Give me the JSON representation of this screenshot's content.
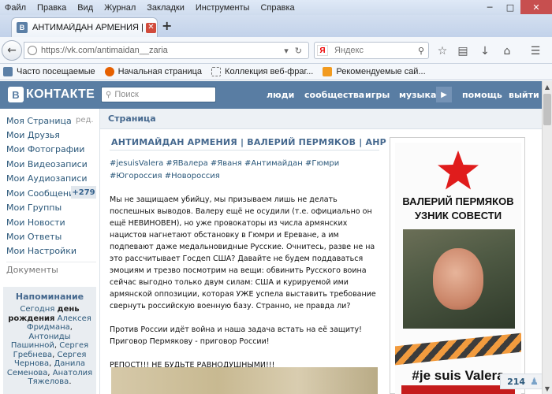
{
  "browser": {
    "menu": [
      "Файл",
      "Правка",
      "Вид",
      "Журнал",
      "Закладки",
      "Инструменты",
      "Справка"
    ],
    "tab_title": "АНТИМАЙДАН АРМЕНИЯ | В...",
    "tab_favicon": "В",
    "url": "https://vk.com/antimaidan__zaria",
    "search_engine_logo": "Я",
    "search_placeholder": "Яндекс",
    "bookmarks": [
      {
        "label": "Часто посещаемые",
        "icon": "vk-icon"
      },
      {
        "label": "Начальная страница",
        "icon": "firefox-icon"
      },
      {
        "label": "Коллекция веб-фраг...",
        "icon": "webslice-icon"
      },
      {
        "label": "Рекомендуемые сай...",
        "icon": "bookmark-icon"
      }
    ],
    "new_tab": "+",
    "tab_close": "✕"
  },
  "vk": {
    "logo_letter": "В",
    "logo_text": "КОНТАКТЕ",
    "search_placeholder": "Поиск",
    "nav": [
      "люди",
      "сообщества",
      "игры",
      "музыка",
      "помощь",
      "выйти"
    ]
  },
  "sidebar": {
    "items": [
      "Моя Страница",
      "Мои Друзья",
      "Мои Фотографии",
      "Мои Видеозаписи",
      "Мои Аудиозаписи",
      "Мои Сообщения",
      "Мои Группы",
      "Мои Новости",
      "Мои Ответы",
      "Мои Настройки"
    ],
    "edit_label": "ред.",
    "messages_count": "+279",
    "documents": "Документы",
    "reminder_title": "Напоминание",
    "reminder_today": "Сегодня",
    "reminder_birthday": "день рождения",
    "reminder_names": [
      "Алексея Фридмана",
      "Антониды Пашинной",
      "Сергея Гребнева",
      "Сергея Чернова",
      "Данила Семенова",
      "Анатолия Тяжелова"
    ]
  },
  "main": {
    "header": "Страница",
    "post_title": "АНТИМАЙДАН АРМЕНИЯ | ВАЛЕРИЙ ПЕРМЯКОВ | АНР",
    "tags": "#jesuisValera #ЯВалера #Яваня #Антимайдан #Гюмри #Югороссия #Новороссия",
    "paragraphs": [
      "Мы не защищаем убийцу, мы призываем лишь не делать поспешных выводов. Валеру ещё не осудили (т.е. официально он ещё НЕВИНОВЕН), но уже провокаторы из числа армянских нацистов нагнетают обстановку в Гюмри и Ереване, а им подпевают даже медальновидные Русские. Очнитесь, разве не на это рассчитывает Госдеп США? Давайте не будем поддаваться эмоциям и трезво посмотрим на вещи: обвинить Русского воина сейчас выгодно только двум силам: США и курируемой ими армянской оппозиции, которая УЖЕ успела выставить требование свернуть российскую военную базу. Странно, не правда ли?",
      "Против России идёт война и наша задача встать на её защиту! Приговор Пермякову - приговор России!",
      "РЕПОСТ!!! НЕ БУДЬТЕ РАВНОДУШНЫМИ!!!"
    ],
    "poster_name_line1": "ВАЛЕРИЙ ПЕРМЯКОВ",
    "poster_name_line2": "УЗНИК СОВЕСТИ",
    "poster_tag": "#je suis Valera",
    "likes": "214"
  },
  "colors": {
    "vk_header": "#597da3",
    "link": "#2b587a",
    "title": "#45688e",
    "star": "#e01c1c"
  }
}
